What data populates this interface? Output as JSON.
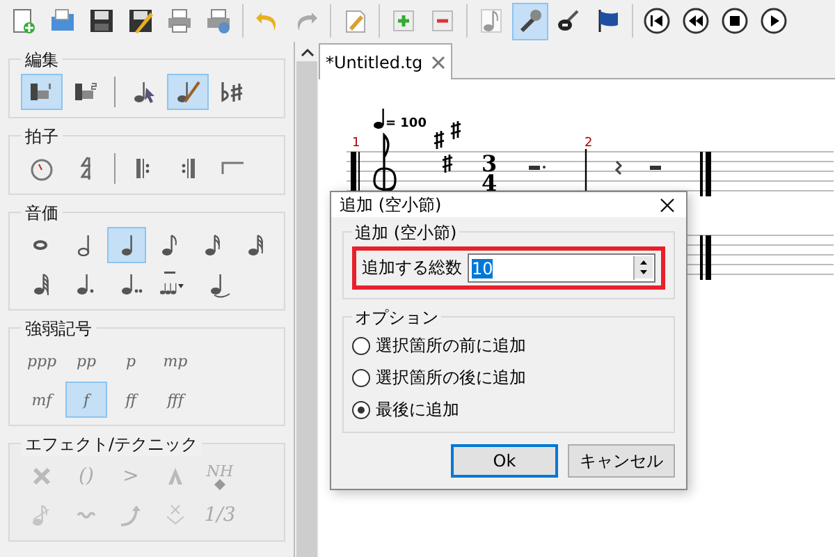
{
  "toolbar": {
    "groups": [
      [
        {
          "selected": false
        },
        {
          "selected": false
        },
        {
          "selected": false
        },
        {
          "selected": false
        },
        {
          "selected": false
        },
        {
          "selected": false
        }
      ],
      [
        {
          "selected": false
        },
        {
          "selected": false
        }
      ],
      [
        {
          "selected": false
        }
      ],
      [
        {
          "selected": false
        },
        {
          "selected": false
        }
      ],
      [
        {
          "selected": false
        },
        {
          "selected": true
        },
        {
          "selected": false
        },
        {
          "selected": false
        }
      ],
      [
        {
          "selected": false
        },
        {
          "selected": false
        },
        {
          "selected": false
        },
        {
          "selected": false
        }
      ]
    ]
  },
  "palette": {
    "sections": [
      {
        "title": "編集",
        "disabled": false,
        "rows": [
          [
            [
              {
                "selected": true
              },
              {
                "selected": false
              }
            ],
            [
              {
                "selected": false
              },
              {
                "selected": true
              },
              {
                "selected": false
              }
            ]
          ]
        ]
      },
      {
        "title": "拍子",
        "disabled": false,
        "rows": [
          [
            [
              {
                "selected": false
              },
              {
                "selected": false
              }
            ],
            [
              {
                "selected": false
              },
              {
                "selected": false
              },
              {
                "selected": false
              }
            ]
          ]
        ]
      },
      {
        "title": "音価",
        "disabled": false,
        "rows": [
          [
            [
              {
                "selected": false
              },
              {
                "selected": false
              },
              {
                "selected": true
              },
              {
                "selected": false
              },
              {
                "selected": false
              },
              {
                "selected": false
              }
            ]
          ],
          [
            [
              {
                "selected": false
              },
              {
                "selected": false
              },
              {
                "selected": false
              },
              {
                "selected": false
              },
              {
                "selected": false
              }
            ]
          ]
        ]
      },
      {
        "title": "強弱記号",
        "disabled": false,
        "rows": [
          [
            [
              {
                "kind": "text",
                "label": "ppp",
                "selected": false
              },
              {
                "kind": "text",
                "label": "pp",
                "selected": false
              },
              {
                "kind": "text",
                "label": "p",
                "selected": false
              },
              {
                "kind": "text",
                "label": "mp",
                "selected": false
              }
            ]
          ],
          [
            [
              {
                "kind": "text",
                "label": "mf",
                "selected": false
              },
              {
                "kind": "text",
                "label": "f",
                "selected": true
              },
              {
                "kind": "text",
                "label": "ff",
                "selected": false
              },
              {
                "kind": "text",
                "label": "fff",
                "selected": false
              }
            ]
          ]
        ]
      },
      {
        "title": "エフェクト/テクニック",
        "disabled": true,
        "rows": [
          [
            [
              {
                "kind": "icon",
                "selected": false
              },
              {
                "kind": "text",
                "label": "()",
                "selected": false
              },
              {
                "kind": "text",
                "label": ">",
                "selected": false
              },
              {
                "kind": "icon",
                "selected": false
              },
              {
                "kind": "harmonic",
                "label": "NH",
                "selected": false
              }
            ]
          ],
          [
            [
              {
                "kind": "icon",
                "selected": false
              },
              {
                "kind": "icon",
                "selected": false
              },
              {
                "kind": "icon",
                "selected": false
              },
              {
                "kind": "icon",
                "selected": false
              },
              {
                "kind": "text",
                "label": "1/3",
                "selected": false
              }
            ]
          ]
        ]
      }
    ]
  },
  "tab": {
    "title": "*Untitled.tg",
    "selected": true
  },
  "score": {
    "tempo": "= 100",
    "measures": [
      "1",
      "2"
    ],
    "time_signature": [
      "3",
      "4"
    ]
  },
  "dialog": {
    "title": "追加 (空小節)",
    "group_title": "追加 (空小節)",
    "count_field": {
      "label": "追加する総数",
      "value": "10",
      "value_selected": true,
      "highlighted": true
    },
    "options_title": "オプション",
    "options": [
      {
        "label": "選択箇所の前に追加",
        "selected": false
      },
      {
        "label": "選択箇所の後に追加",
        "selected": false
      },
      {
        "label": "最後に追加",
        "selected": true
      }
    ],
    "buttons": [
      {
        "label": "Ok",
        "default": true
      },
      {
        "label": "キャンセル",
        "default": false
      }
    ]
  }
}
